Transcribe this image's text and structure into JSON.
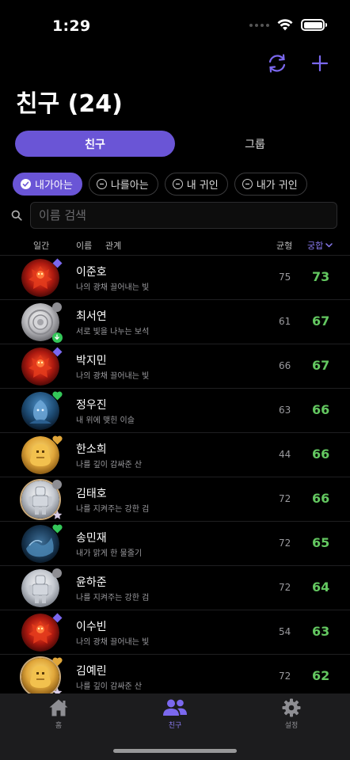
{
  "status_bar": {
    "time": "1:29"
  },
  "header": {
    "title": "친구 (24)"
  },
  "segment": {
    "tabs": [
      {
        "label": "친구",
        "active": true
      },
      {
        "label": "그룹",
        "active": false
      }
    ]
  },
  "filters": [
    {
      "label": "내가아는",
      "active": true
    },
    {
      "label": "나를아는",
      "active": false
    },
    {
      "label": "내 귀인",
      "active": false
    },
    {
      "label": "내가 귀인",
      "active": false
    }
  ],
  "search": {
    "placeholder": "이름 검색"
  },
  "columns": {
    "daygan": "일간",
    "name": "이름",
    "relation": "관계",
    "balance": "균형",
    "compat": "궁합"
  },
  "colors": {
    "accent": "#6a55d6",
    "score": "#63c760",
    "badge_purple": "#7b68ee",
    "badge_heart_green": "#34c759",
    "badge_heart_gold": "#e0a63a"
  },
  "friends": [
    {
      "name": "이준호",
      "desc": "나의 광채 끌어내는 빛",
      "balance": "75",
      "score": "73",
      "avatar": "fire-figure",
      "badge": "purple-diamond-icon",
      "ring": false
    },
    {
      "name": "최서연",
      "desc": "서로 빛을 나누는 보석",
      "balance": "61",
      "score": "67",
      "avatar": "silver-orb",
      "badge": "gray-dot-icon",
      "badge2": "download-icon",
      "ring": false
    },
    {
      "name": "박지민",
      "desc": "나의 광채 끌어내는 빛",
      "balance": "66",
      "score": "67",
      "avatar": "fire-figure",
      "badge": "purple-diamond-icon",
      "ring": false
    },
    {
      "name": "정우진",
      "desc": "내 위에 맺힌 이슬",
      "balance": "63",
      "score": "66",
      "avatar": "water-figure",
      "badge": "green-heart-icon",
      "ring": false
    },
    {
      "name": "한소희",
      "desc": "나를 깊이 감싸준 산",
      "balance": "44",
      "score": "66",
      "avatar": "earth-figure",
      "badge": "gold-heart-icon",
      "ring": false
    },
    {
      "name": "김태호",
      "desc": "나를 지켜주는 강한 검",
      "balance": "72",
      "score": "66",
      "avatar": "metal-figure",
      "badge": "gray-dot-icon",
      "badge2": "star-icon",
      "ring": true
    },
    {
      "name": "송민재",
      "desc": "내가 맑게 한 물줄기",
      "balance": "72",
      "score": "65",
      "avatar": "wave-figure",
      "badge": "green-heart-icon",
      "ring": false
    },
    {
      "name": "윤하준",
      "desc": "나를 지켜주는 강한 검",
      "balance": "72",
      "score": "64",
      "avatar": "metal-figure",
      "badge": "gray-dot-icon",
      "ring": false
    },
    {
      "name": "이수빈",
      "desc": "나의 광채 끌어내는 빛",
      "balance": "54",
      "score": "63",
      "avatar": "fire-figure",
      "badge": "purple-diamond-icon",
      "ring": false
    },
    {
      "name": "김예린",
      "desc": "나를 깊이 감싸준 산",
      "balance": "72",
      "score": "62",
      "avatar": "earth-figure",
      "badge": "gold-heart-icon",
      "badge2": "star-icon",
      "ring": true
    }
  ],
  "tab_bar": [
    {
      "label": "홈",
      "icon": "home-icon",
      "active": false
    },
    {
      "label": "친구",
      "icon": "people-icon",
      "active": true
    },
    {
      "label": "설정",
      "icon": "gear-icon",
      "active": false
    }
  ]
}
